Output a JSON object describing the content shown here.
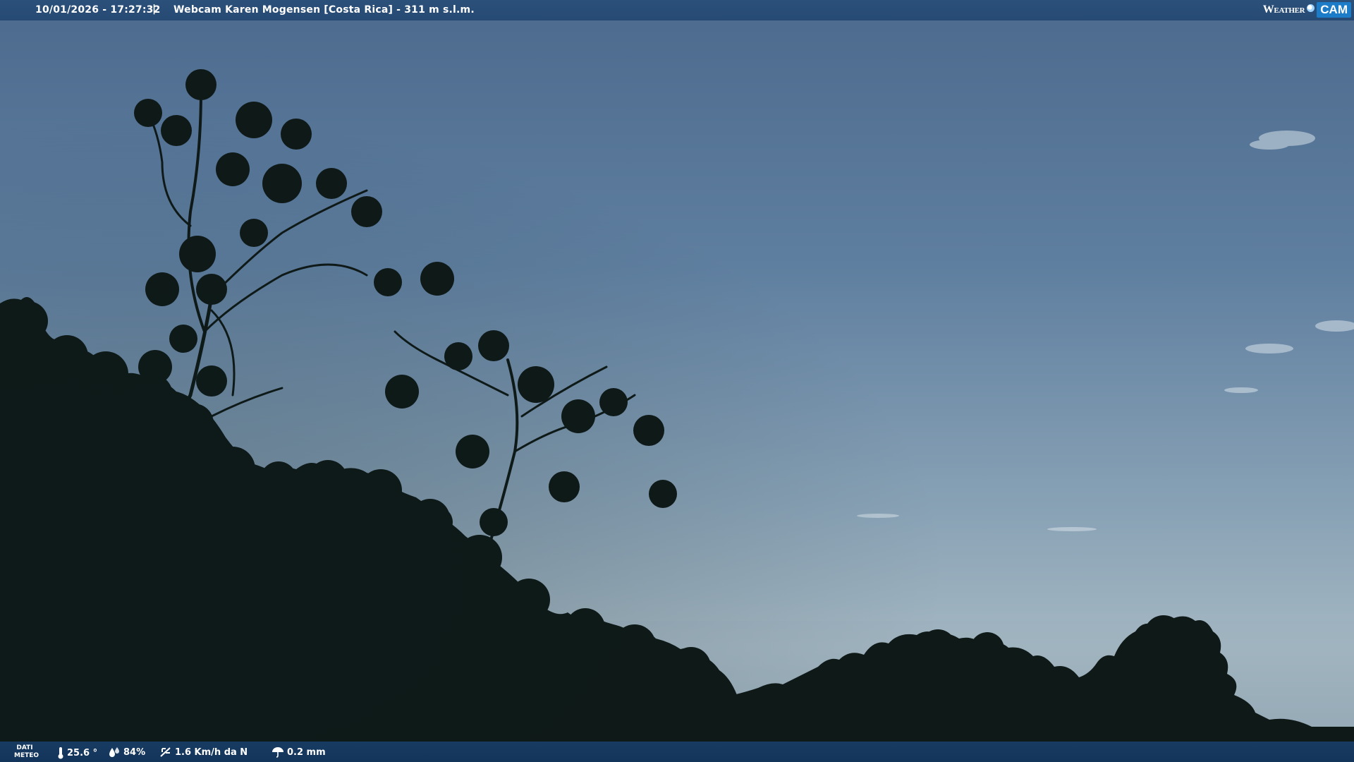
{
  "overlay": {
    "timestamp": "10/01/2026 - 17:27:32",
    "separator": "|",
    "title": "Webcam Karen Mogensen [Costa Rica]  - 311 m s.l.m.",
    "brand": {
      "prefix": "Weather",
      "suffix": "CAM"
    }
  },
  "weather": {
    "label_line1": "DATI",
    "label_line2": "METEO",
    "temperature": "25.6 °",
    "humidity": "84%",
    "wind": "1.6 Km/h da N",
    "rain": "0.2 mm"
  },
  "scene": {
    "sky_top": "#4d6c8f",
    "sky_horizon": "#a6b9c4",
    "silhouette": "#0f1a18"
  },
  "colors": {
    "bar": "#264a73",
    "brand_accent": "#1d7cc7"
  }
}
